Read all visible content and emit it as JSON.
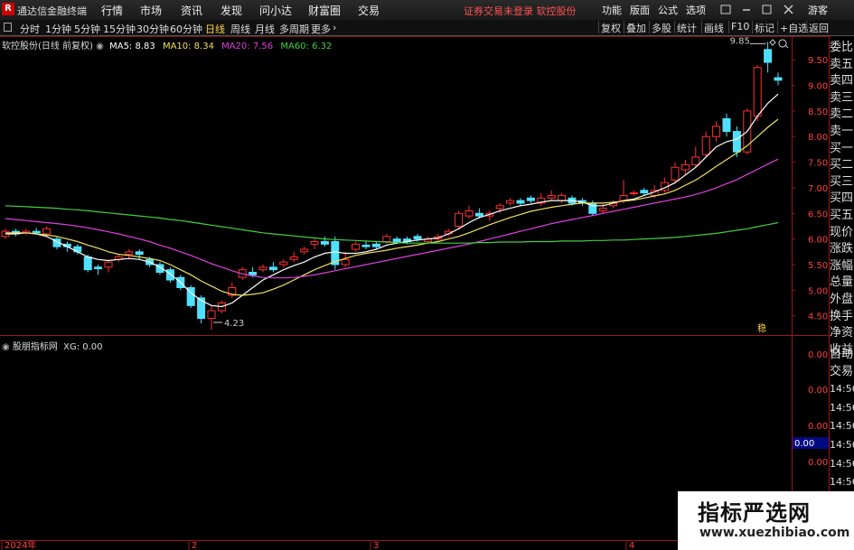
{
  "app": {
    "title": "通达信金融终端",
    "logo": "R"
  },
  "menu": [
    "行情",
    "市场",
    "资讯",
    "发现",
    "问小达",
    "财富圈",
    "交易"
  ],
  "status": "证券交易未登录  软控股份",
  "right_menu": [
    "功能",
    "版面",
    "公式",
    "选项"
  ],
  "user": "游客",
  "periods": [
    "分时",
    "1分钟",
    "5分钟",
    "15分钟",
    "30分钟",
    "60分钟",
    "日线",
    "周线",
    "月线",
    "多周期",
    "更多"
  ],
  "active_period": "日线",
  "tools": [
    "复权",
    "叠加",
    "多股",
    "统计",
    "画线",
    "F10",
    "标记",
    "+自选",
    "返回"
  ],
  "main_chart": {
    "stock_label": "软控股份(日线 前复权)",
    "ma": [
      {
        "label": "MA5: 8.83",
        "color": "#ffffff"
      },
      {
        "label": "MA10: 8.34",
        "color": "#f0e060"
      },
      {
        "label": "MA20: 7.56",
        "color": "#e040e0"
      },
      {
        "label": "MA60: 6.32",
        "color": "#40d040"
      }
    ],
    "high_label": "9.85",
    "low_label": "4.23",
    "marker": "稳",
    "y_ticks": [
      "9.50",
      "9.00",
      "8.50",
      "8.00",
      "7.50",
      "7.00",
      "6.50",
      "6.00",
      "5.50",
      "5.00",
      "4.50"
    ]
  },
  "sub_chart": {
    "label": "股朋指标网",
    "value": "XG: 0.00",
    "y_ticks": [
      "0.00",
      "0.00",
      "0.00",
      "0.00"
    ],
    "current_value": "0.00"
  },
  "x_labels": [
    "2024年",
    "2",
    "3",
    "4"
  ],
  "side_panel": [
    "委比",
    "卖五",
    "卖四",
    "卖三",
    "卖二",
    "卖一",
    "买一",
    "买二",
    "买三",
    "买四",
    "买五",
    "现价",
    "涨跌",
    "涨幅",
    "总量",
    "外盘",
    "换手",
    "净资",
    "收益"
  ],
  "side_panel2": [
    "自动",
    "交易",
    "14:56",
    "14:56",
    "14:56",
    "14:56",
    "14:56",
    "14:56",
    "14:56",
    "14:56",
    "14:56"
  ],
  "watermark": {
    "line1": "指标严选网",
    "line2": "www.xuezhibiao.com"
  },
  "colors": {
    "up": "#ff3030",
    "down": "#50e0ff",
    "bg": "#000000",
    "grid": "#7a1010"
  },
  "chart_data": {
    "type": "candlestick",
    "ylim": [
      4.0,
      10.0
    ],
    "candles": [
      [
        6.05,
        6.15,
        6.2,
        6.0
      ],
      [
        6.15,
        6.1,
        6.2,
        6.05
      ],
      [
        6.12,
        6.15,
        6.2,
        6.08
      ],
      [
        6.15,
        6.12,
        6.22,
        6.08
      ],
      [
        6.1,
        6.2,
        6.25,
        6.05
      ],
      [
        6.0,
        5.85,
        6.05,
        5.8
      ],
      [
        5.9,
        5.85,
        5.95,
        5.75
      ],
      [
        5.85,
        5.75,
        5.9,
        5.7
      ],
      [
        5.65,
        5.4,
        5.7,
        5.35
      ],
      [
        5.45,
        5.42,
        5.5,
        5.3
      ],
      [
        5.45,
        5.55,
        5.6,
        5.35
      ],
      [
        5.6,
        5.65,
        5.7,
        5.55
      ],
      [
        5.7,
        5.75,
        5.8,
        5.6
      ],
      [
        5.75,
        5.7,
        5.8,
        5.6
      ],
      [
        5.6,
        5.5,
        5.65,
        5.45
      ],
      [
        5.5,
        5.35,
        5.55,
        5.3
      ],
      [
        5.4,
        5.2,
        5.45,
        5.15
      ],
      [
        5.25,
        5.05,
        5.3,
        5.0
      ],
      [
        5.05,
        4.7,
        5.1,
        4.65
      ],
      [
        4.85,
        4.45,
        4.9,
        4.35
      ],
      [
        4.45,
        4.6,
        4.7,
        4.23
      ],
      [
        4.6,
        4.75,
        4.8,
        4.55
      ],
      [
        4.9,
        5.05,
        5.15,
        4.85
      ],
      [
        5.25,
        5.4,
        5.45,
        5.2
      ],
      [
        5.35,
        5.3,
        5.45,
        5.25
      ],
      [
        5.4,
        5.45,
        5.5,
        5.35
      ],
      [
        5.45,
        5.4,
        5.55,
        5.35
      ],
      [
        5.5,
        5.55,
        5.6,
        5.45
      ],
      [
        5.6,
        5.65,
        5.75,
        5.55
      ],
      [
        5.75,
        5.8,
        5.85,
        5.7
      ],
      [
        5.9,
        5.95,
        6.0,
        5.8
      ],
      [
        5.95,
        5.9,
        6.05,
        5.85
      ],
      [
        5.95,
        5.5,
        6.05,
        5.4
      ],
      [
        5.5,
        5.6,
        5.75,
        5.45
      ],
      [
        5.8,
        5.9,
        5.95,
        5.75
      ],
      [
        5.88,
        5.85,
        5.95,
        5.8
      ],
      [
        5.9,
        5.85,
        5.95,
        5.8
      ],
      [
        5.95,
        6.05,
        6.1,
        5.9
      ],
      [
        6.0,
        5.95,
        6.05,
        5.9
      ],
      [
        6.0,
        5.95,
        6.05,
        5.9
      ],
      [
        6.05,
        6.0,
        6.1,
        5.95
      ],
      [
        5.95,
        6.0,
        6.05,
        5.9
      ],
      [
        6.0,
        6.05,
        6.1,
        5.95
      ],
      [
        6.1,
        6.15,
        6.2,
        6.05
      ],
      [
        6.25,
        6.5,
        6.55,
        6.2
      ],
      [
        6.45,
        6.55,
        6.65,
        6.4
      ],
      [
        6.5,
        6.45,
        6.6,
        6.4
      ],
      [
        6.45,
        6.5,
        6.55,
        6.35
      ],
      [
        6.6,
        6.65,
        6.7,
        6.5
      ],
      [
        6.7,
        6.75,
        6.8,
        6.65
      ],
      [
        6.75,
        6.7,
        6.8,
        6.65
      ],
      [
        6.8,
        6.75,
        6.85,
        6.7
      ],
      [
        6.7,
        6.8,
        6.9,
        6.65
      ],
      [
        6.8,
        6.85,
        6.95,
        6.75
      ],
      [
        6.75,
        6.85,
        6.9,
        6.7
      ],
      [
        6.8,
        6.7,
        6.85,
        6.65
      ],
      [
        6.75,
        6.7,
        6.8,
        6.65
      ],
      [
        6.7,
        6.5,
        6.75,
        6.45
      ],
      [
        6.55,
        6.6,
        6.7,
        6.5
      ],
      [
        6.65,
        6.7,
        6.75,
        6.6
      ],
      [
        6.75,
        6.85,
        7.15,
        6.7
      ],
      [
        6.9,
        6.9,
        6.95,
        6.85
      ],
      [
        6.95,
        6.9,
        7.0,
        6.85
      ],
      [
        6.85,
        6.95,
        7.05,
        6.8
      ],
      [
        6.95,
        7.1,
        7.2,
        6.9
      ],
      [
        7.15,
        7.4,
        7.5,
        7.1
      ],
      [
        7.35,
        7.45,
        7.55,
        7.25
      ],
      [
        7.45,
        7.6,
        7.8,
        7.4
      ],
      [
        7.65,
        8.0,
        8.1,
        7.6
      ],
      [
        8.0,
        8.2,
        8.3,
        7.9
      ],
      [
        8.35,
        8.1,
        8.45,
        8.0
      ],
      [
        8.1,
        7.7,
        8.2,
        7.6
      ],
      [
        7.7,
        8.5,
        8.55,
        7.65
      ],
      [
        8.4,
        9.35,
        9.4,
        8.3
      ],
      [
        9.7,
        9.45,
        9.85,
        9.25
      ],
      [
        9.15,
        9.1,
        9.25,
        9.0
      ]
    ],
    "ma5": [
      6.1,
      6.1,
      6.12,
      6.1,
      6.05,
      5.95,
      5.85,
      5.75,
      5.65,
      5.6,
      5.58,
      5.6,
      5.62,
      5.6,
      5.55,
      5.45,
      5.32,
      5.15,
      4.95,
      4.8,
      4.7,
      4.68,
      4.75,
      4.9,
      5.05,
      5.2,
      5.3,
      5.4,
      5.48,
      5.55,
      5.65,
      5.72,
      5.75,
      5.72,
      5.72,
      5.75,
      5.8,
      5.88,
      5.92,
      5.95,
      5.98,
      6.0,
      6.02,
      6.1,
      6.2,
      6.32,
      6.42,
      6.48,
      6.55,
      6.6,
      6.65,
      6.68,
      6.72,
      6.75,
      6.75,
      6.75,
      6.72,
      6.65,
      6.65,
      6.7,
      6.75,
      6.78,
      6.85,
      6.92,
      7.0,
      7.1,
      7.25,
      7.4,
      7.6,
      7.8,
      7.9,
      7.95,
      8.1,
      8.4,
      8.65,
      8.83
    ],
    "ma10": [
      6.12,
      6.12,
      6.12,
      6.1,
      6.08,
      6.05,
      6.0,
      5.95,
      5.88,
      5.82,
      5.75,
      5.7,
      5.68,
      5.65,
      5.62,
      5.58,
      5.5,
      5.4,
      5.3,
      5.18,
      5.08,
      4.98,
      4.92,
      4.9,
      4.92,
      4.95,
      5.02,
      5.1,
      5.2,
      5.3,
      5.4,
      5.48,
      5.56,
      5.62,
      5.68,
      5.72,
      5.75,
      5.78,
      5.82,
      5.85,
      5.88,
      5.92,
      5.95,
      6.0,
      6.05,
      6.12,
      6.2,
      6.28,
      6.35,
      6.42,
      6.48,
      6.54,
      6.58,
      6.62,
      6.65,
      6.68,
      6.7,
      6.7,
      6.7,
      6.72,
      6.74,
      6.76,
      6.8,
      6.84,
      6.88,
      6.95,
      7.05,
      7.15,
      7.28,
      7.42,
      7.55,
      7.68,
      7.82,
      8.0,
      8.18,
      8.34
    ],
    "ma20": [
      6.4,
      6.38,
      6.36,
      6.34,
      6.32,
      6.3,
      6.28,
      6.25,
      6.22,
      6.18,
      6.14,
      6.1,
      6.05,
      6.0,
      5.95,
      5.88,
      5.82,
      5.75,
      5.68,
      5.6,
      5.52,
      5.45,
      5.38,
      5.32,
      5.28,
      5.25,
      5.24,
      5.24,
      5.25,
      5.27,
      5.3,
      5.34,
      5.38,
      5.42,
      5.46,
      5.5,
      5.54,
      5.58,
      5.62,
      5.66,
      5.7,
      5.74,
      5.78,
      5.82,
      5.86,
      5.9,
      5.95,
      6.0,
      6.05,
      6.1,
      6.15,
      6.2,
      6.25,
      6.3,
      6.34,
      6.38,
      6.42,
      6.46,
      6.5,
      6.54,
      6.58,
      6.62,
      6.66,
      6.7,
      6.74,
      6.78,
      6.82,
      6.87,
      6.93,
      7.0,
      7.08,
      7.16,
      7.26,
      7.36,
      7.46,
      7.56
    ],
    "ma60": [
      6.65,
      6.64,
      6.63,
      6.62,
      6.61,
      6.6,
      6.58,
      6.57,
      6.55,
      6.53,
      6.51,
      6.49,
      6.47,
      6.45,
      6.43,
      6.41,
      6.38,
      6.36,
      6.33,
      6.3,
      6.27,
      6.24,
      6.21,
      6.18,
      6.15,
      6.12,
      6.1,
      6.08,
      6.06,
      6.04,
      6.02,
      6.0,
      5.99,
      5.98,
      5.97,
      5.96,
      5.95,
      5.94,
      5.93,
      5.92,
      5.92,
      5.92,
      5.92,
      5.92,
      5.92,
      5.92,
      5.93,
      5.93,
      5.94,
      5.94,
      5.94,
      5.95,
      5.95,
      5.95,
      5.96,
      5.96,
      5.96,
      5.97,
      5.97,
      5.98,
      5.98,
      5.99,
      6.0,
      6.01,
      6.02,
      6.03,
      6.05,
      6.07,
      6.09,
      6.11,
      6.14,
      6.17,
      6.2,
      6.24,
      6.28,
      6.32
    ]
  }
}
